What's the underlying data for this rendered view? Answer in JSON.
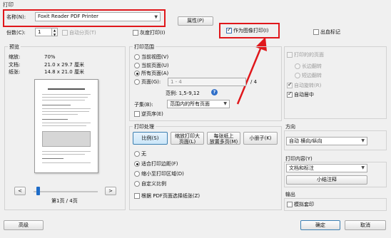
{
  "window": {
    "title": "打印"
  },
  "printer": {
    "name_label": "名称(N):",
    "name_value": "Foxit Reader PDF Printer",
    "properties_button": "属性(P)",
    "copies_label": "份数(C):",
    "copies_value": "1",
    "collate_label": "自动分页(T)",
    "grayscale_label": "灰度打印(I)",
    "print_as_image_label": "作为图像打印(I)",
    "print_as_image_checked": true,
    "print_to_file_label": "出血标记"
  },
  "preview": {
    "heading": "预览",
    "zoom_label": "缩放:",
    "zoom_value": "70%",
    "document_label": "文档:",
    "document_size": "21.0 x 29.7 厘米",
    "paper_label": "纸张:",
    "paper_size": "14.8 x 21.0 厘米",
    "prev_button": "<",
    "next_button": ">",
    "page_indicator": "第1页 / 4页"
  },
  "print_range": {
    "heading": "打印范围",
    "current_view": "当前视图(V)",
    "current_page": "当前页面(U)",
    "all_pages": "所有页面(A)",
    "pages_label": "页面(G):",
    "pages_placeholder": "1 - 4",
    "pages_total": "/ 4",
    "example": "范例: 1,5-9,12",
    "subset_label": "子集(B):",
    "subset_value": "范围内的所有页面",
    "reverse_label": "逆页序(E)"
  },
  "print_handling": {
    "heading": "打印处理",
    "tabs": [
      "比例(S)",
      "缩放打印大\n页面(L)",
      "每张纸上\n放置多页(M)",
      "小册子(K)"
    ],
    "none": "无",
    "fit": "适合打印边距(F)",
    "shrink": "缩小至打印区域(D)",
    "custom": "自定义比例",
    "choose_paper": "根据 PDF页面选择纸张(Z)"
  },
  "sides": {
    "odd_even": "打印的的页面",
    "long_edge": "长边翻转",
    "short_edge": "短边翻转",
    "auto_rotate": "自动旋转(R)",
    "auto_center": "自动居中"
  },
  "orientation": {
    "heading": "方向",
    "value": "自动 横向/纵向"
  },
  "content": {
    "heading": "打印内容(Y)",
    "value": "文档和标注",
    "summary_button": "小结注释"
  },
  "output": {
    "heading": "输出",
    "simulate_label": "模拟套印"
  },
  "footer": {
    "advanced": "高级",
    "ok": "确定",
    "cancel": "取消"
  },
  "annotation": {
    "color": "#e0171b"
  }
}
